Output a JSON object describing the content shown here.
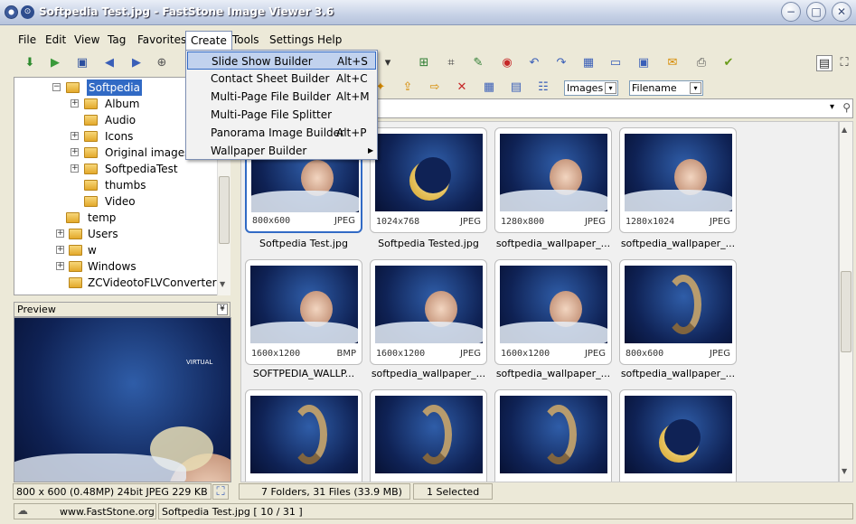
{
  "window": {
    "title": "Softpedia Test.jpg  -  FastStone Image Viewer 3.6",
    "minimize_glyph": "−",
    "maximize_glyph": "□",
    "close_glyph": "✕"
  },
  "menu": [
    "File",
    "Edit",
    "View",
    "Tag",
    "Favorites",
    "Create",
    "Tools",
    "Settings",
    "Help"
  ],
  "create_menu": [
    {
      "label": "Slide Show Builder",
      "shortcut": "Alt+S",
      "highlighted": true
    },
    {
      "label": "Contact Sheet Builder",
      "shortcut": "Alt+C"
    },
    {
      "label": "Multi-Page File Builder",
      "shortcut": "Alt+M"
    },
    {
      "label": "Multi-Page File Splitter",
      "shortcut": ""
    },
    {
      "label": "Panorama Image Builder",
      "shortcut": "Alt+P"
    },
    {
      "label": "Wallpaper Builder",
      "shortcut": "",
      "submenu_arrow": "▶"
    }
  ],
  "tree": [
    {
      "label": "Softpedia",
      "selected": true,
      "expanded": true
    },
    {
      "label": "Album",
      "has_children": true
    },
    {
      "label": "Audio"
    },
    {
      "label": "Icons",
      "has_children": true
    },
    {
      "label": "Original images",
      "has_children": true
    },
    {
      "label": "SoftpediaTest",
      "has_children": true
    },
    {
      "label": "thumbs"
    },
    {
      "label": "Video"
    },
    {
      "label": "temp"
    },
    {
      "label": "Users",
      "has_children": true
    },
    {
      "label": "w",
      "has_children": true
    },
    {
      "label": "Windows",
      "has_children": true
    },
    {
      "label": "ZCVideotoFLVConverter"
    }
  ],
  "preview": {
    "label": "Preview",
    "collapse_glyph": "¥",
    "image_text": "VIRTUAL"
  },
  "toolbar2": {
    "filter": "Images",
    "sort": "Filename"
  },
  "thumbnails": [
    {
      "caption": "Softpedia Test.jpg",
      "res": "800x600",
      "fmt": "JPEG",
      "style": "girl",
      "selected": true
    },
    {
      "caption": "Softpedia Tested.jpg",
      "res": "1024x768",
      "fmt": "JPEG",
      "style": "moon"
    },
    {
      "caption": "softpedia_wallpaper_...",
      "res": "1280x800",
      "fmt": "JPEG",
      "style": "girl"
    },
    {
      "caption": "softpedia_wallpaper_...",
      "res": "1280x1024",
      "fmt": "JPEG",
      "style": "girl"
    },
    {
      "caption": "SOFTPEDIA_WALLP...",
      "res": "1600x1200",
      "fmt": "BMP",
      "style": "girl"
    },
    {
      "caption": "softpedia_wallpaper_...",
      "res": "1600x1200",
      "fmt": "JPEG",
      "style": "girl"
    },
    {
      "caption": "softpedia_wallpaper_...",
      "res": "1600x1200",
      "fmt": "JPEG",
      "style": "girl"
    },
    {
      "caption": "softpedia_wallpaper_...",
      "res": "800x600",
      "fmt": "JPEG",
      "style": "swirl"
    },
    {
      "caption": "",
      "res": "",
      "fmt": "",
      "style": "swirl"
    },
    {
      "caption": "",
      "res": "",
      "fmt": "",
      "style": "swirl"
    },
    {
      "caption": "",
      "res": "",
      "fmt": "",
      "style": "swirl"
    },
    {
      "caption": "",
      "res": "",
      "fmt": "",
      "style": "moon"
    }
  ],
  "status": {
    "image_info": "800 x 600 (0.48MP)  24bit JPEG  229 KB  20",
    "folder_info": "7 Folders, 31 Files (33.9 MB)",
    "selected": "1 Selected",
    "website": "www.FastStone.org",
    "file_info": "Softpedia Test.jpg [ 10 / 31 ]"
  },
  "colors": {
    "accent": "#316AC5",
    "menu_highlight": "#C1D2EE",
    "thumb_bg": "#0F2255"
  }
}
